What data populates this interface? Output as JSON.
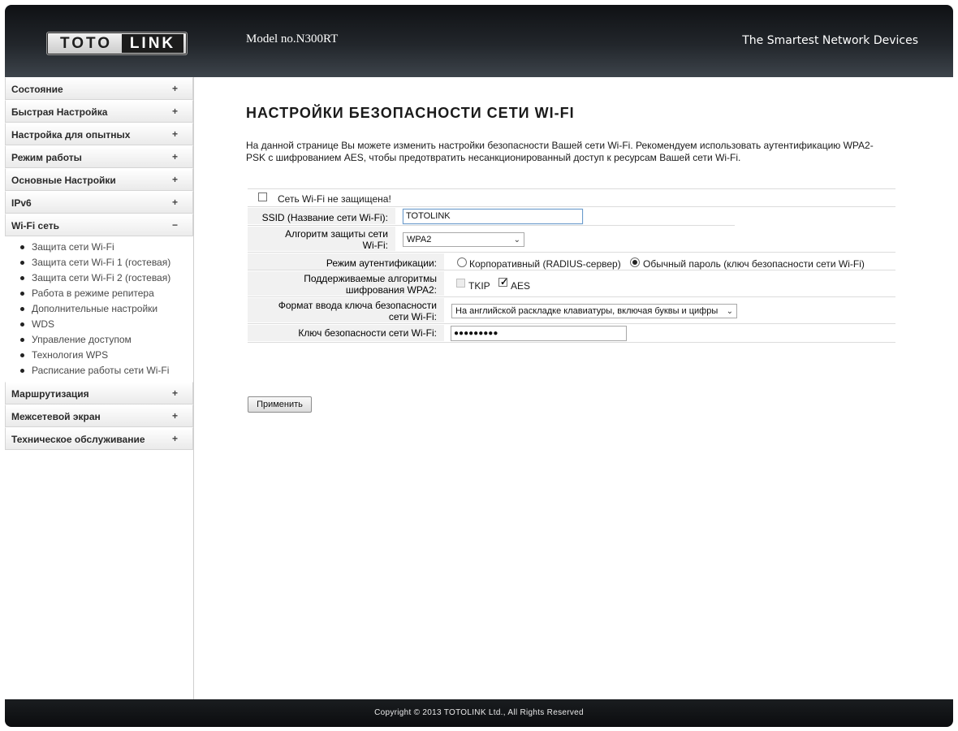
{
  "header": {
    "logo_text": "TOTOLINK",
    "logo_left": "TOTO",
    "logo_right": "LINK",
    "model": "Model no.N300RT",
    "tagline": "The Smartest Network Devices"
  },
  "sidebar": {
    "menus_top": [
      {
        "label": "Состояние",
        "toggle": "+"
      },
      {
        "label": "Быстрая Настройка",
        "toggle": "+"
      },
      {
        "label": "Настройка для опытных",
        "toggle": "+"
      },
      {
        "label": "Режим работы",
        "toggle": "+"
      },
      {
        "label": "Основные Настройки",
        "toggle": "+"
      },
      {
        "label": "IPv6",
        "toggle": "+"
      }
    ],
    "wifi_menu": {
      "label": "Wi-Fi сеть",
      "toggle": "−",
      "items": [
        "Защита сети Wi-Fi",
        "Защита сети Wi-Fi 1 (гостевая)",
        "Защита сети Wi-Fi 2 (гостевая)",
        "Работа в режиме репитера",
        "Дополнительные настройки",
        "WDS",
        "Управление доступом",
        "Технология WPS",
        "Расписание работы сети Wi-Fi"
      ]
    },
    "menus_bottom": [
      {
        "label": "Маршрутизация",
        "toggle": "+"
      },
      {
        "label": "Межсетевой экран",
        "toggle": "+"
      },
      {
        "label": "Техническое обслуживание",
        "toggle": "+"
      }
    ]
  },
  "main": {
    "title": "НАСТРОЙКИ БЕЗОПАСНОСТИ СЕТИ WI-FI",
    "description": "На данной странице Вы можете изменить настройки безопасности Вашей сети Wi-Fi. Рекомендуем использовать аутентификацию WPA2-PSK с шифрованием AES, чтобы предотвратить несанкционированный доступ к ресурсам Вашей сети Wi-Fi.",
    "unsecured_checkbox": {
      "label": "Сеть Wi-Fi не защищена!",
      "checked": false
    },
    "ssid": {
      "label": "SSID (Название сети Wi-Fi):",
      "value": "TOTOLINK"
    },
    "algorithm": {
      "label_line1": "Алгоритм защиты сети",
      "label_line2": "Wi-Fi:",
      "value": "WPA2"
    },
    "auth_mode": {
      "label": "Режим аутентификации:",
      "option_enterprise": "Корпоративный (RADIUS-сервер)",
      "option_personal": "Обычный пароль (ключ безопасности сети Wi-Fi)",
      "selected": "personal"
    },
    "ciphers": {
      "label_line1": "Поддерживаемые алгоритмы",
      "label_line2": "шифрования WPA2:",
      "tkip": "TKIP",
      "aes": "AES",
      "tkip_checked": false,
      "aes_checked": true
    },
    "key_format": {
      "label_line1": "Формат ввода ключа безопасности",
      "label_line2": "сети Wi-Fi:",
      "value": "На английской раскладке клавиатуры, включая буквы и цифры"
    },
    "key": {
      "label": "Ключ безопасности сети Wi-Fi:",
      "value": "●●●●●●●●●"
    },
    "apply_button": "Применить"
  },
  "footer": {
    "copyright": "Copyright © 2013 TOTOLINK Ltd.,    All Rights Reserved"
  }
}
